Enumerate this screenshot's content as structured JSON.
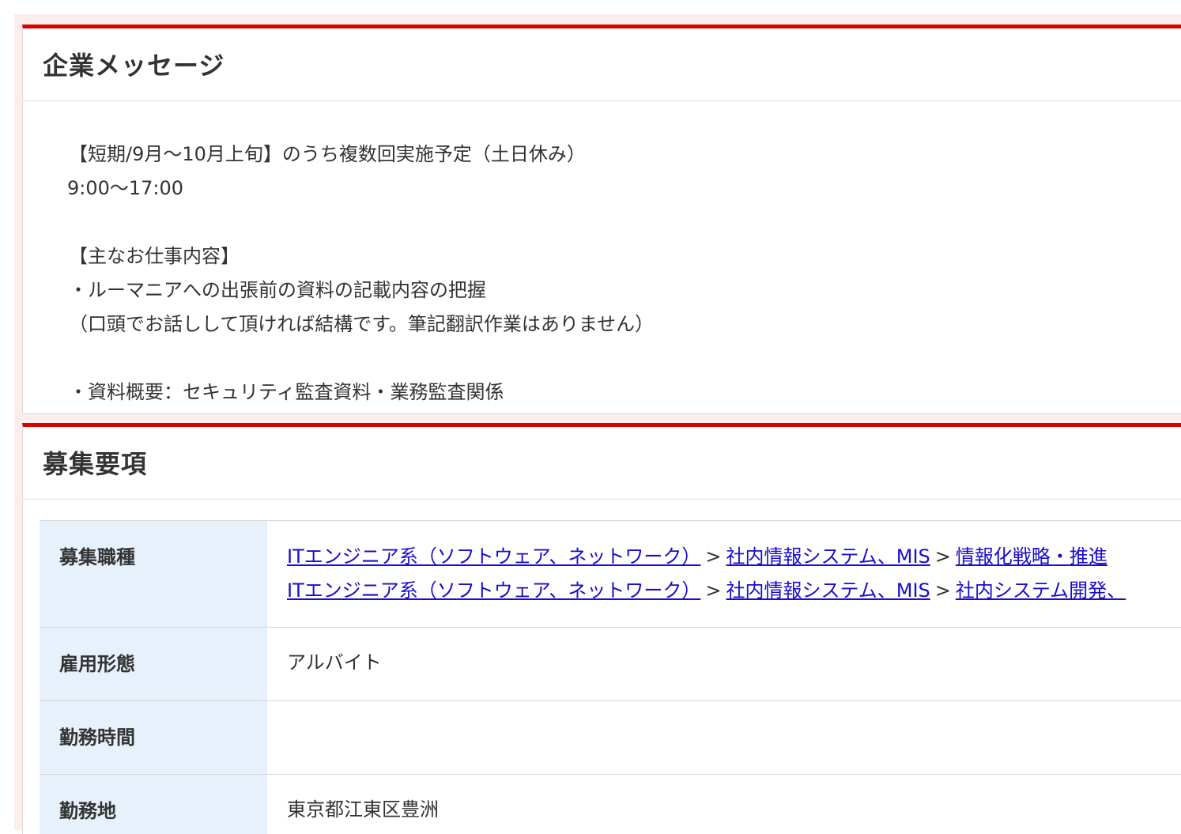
{
  "message_section": {
    "title": "企業メッセージ",
    "lines": [
      "【短期/9月〜10月上旬】のうち複数回実施予定（土日休み）",
      "9:00〜17:00",
      "",
      "【主なお仕事内容】",
      "・ルーマニアへの出張前の資料の記載内容の把握",
      "（口頭でお話しして頂ければ結構です。筆記翻訳作業はありません）",
      "",
      "・資料概要：セキュリティ監査資料・業務監査関係"
    ]
  },
  "requirements_section": {
    "title": "募集要項",
    "rows": {
      "job_type": {
        "label": "募集職種",
        "paths": [
          {
            "category": "ITエンジニア系（ソフトウェア、ネットワーク）",
            "separator1": ">",
            "subcategory": "社内情報システム、MIS",
            "separator2": ">",
            "role": "情報化戦略・推進"
          },
          {
            "category": "ITエンジニア系（ソフトウェア、ネットワーク）",
            "separator1": ">",
            "subcategory": "社内情報システム、MIS",
            "separator2": ">",
            "role": "社内システム開発、"
          }
        ]
      },
      "employment_type": {
        "label": "雇用形態",
        "value": "アルバイト"
      },
      "working_hours": {
        "label": "勤務時間",
        "value": ""
      },
      "location": {
        "label": "勤務地",
        "value": "東京都江東区豊洲"
      }
    }
  },
  "colors": {
    "accent_border": "#d90000",
    "header_cell_bg": "#e6f1fc",
    "link": "#1a0dcc",
    "frame_bg": "#fdeeee"
  }
}
